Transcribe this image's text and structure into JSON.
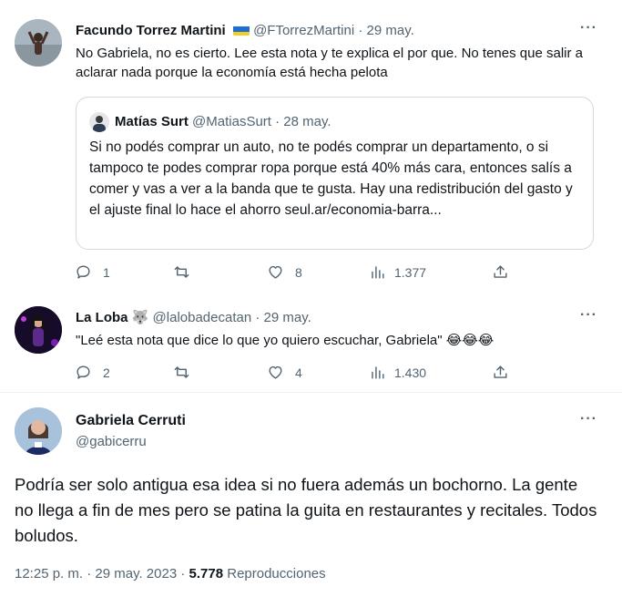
{
  "reply1": {
    "name": "Facundo Torrez Martini",
    "handle": "@FTorrezMartini",
    "separator": "·",
    "date": "29 may.",
    "text": "No Gabriela, no es cierto. Lee esta nota y te explica el por que. No tenes que salir a aclarar nada porque la economía está hecha pelota",
    "quote": {
      "name": "Matías Surt",
      "handle": "@MatiasSurt",
      "separator": "·",
      "date": "28 may.",
      "text": "Si no podés comprar un auto, no te podés comprar un departamento, o si tampoco te podes comprar ropa porque está 40% más cara, entonces salís a comer y vas a ver a la banda que te gusta. Hay una redistribución del gasto y el ajuste final lo hace el ahorro seul.ar/economia-barra..."
    },
    "stats": {
      "replies": "1",
      "retweets": "",
      "likes": "8",
      "views": "1.377"
    }
  },
  "reply2": {
    "name": "La Loba",
    "name_emoji": "🐺",
    "handle": "@lalobadecatan",
    "separator": "·",
    "date": "29 may.",
    "text": "\"Leé esta nota que dice lo que yo quiero escuchar, Gabriela\" 😂😂😂",
    "stats": {
      "replies": "2",
      "retweets": "",
      "likes": "4",
      "views": "1.430"
    }
  },
  "main": {
    "name": "Gabriela Cerruti",
    "handle": "@gabicerru",
    "text": "Podría ser solo antigua esa idea si no fuera además un bochorno. La gente no llega a fin de mes pero se patina la guita en restaurantes y recitales. Todos boludos.",
    "time": "12:25 p. m.",
    "separator": "·",
    "date": "29 may. 2023",
    "separator2": "·",
    "views": "5.778",
    "views_label": "Reproducciones"
  },
  "more_label": "···",
  "colors": {
    "text": "#0f1419",
    "secondary": "#536471",
    "border": "#cfd9de"
  },
  "icons": [
    "reply-icon",
    "retweet-icon",
    "like-icon",
    "views-icon",
    "share-icon",
    "more-icon",
    "ukraine-flag-icon"
  ]
}
